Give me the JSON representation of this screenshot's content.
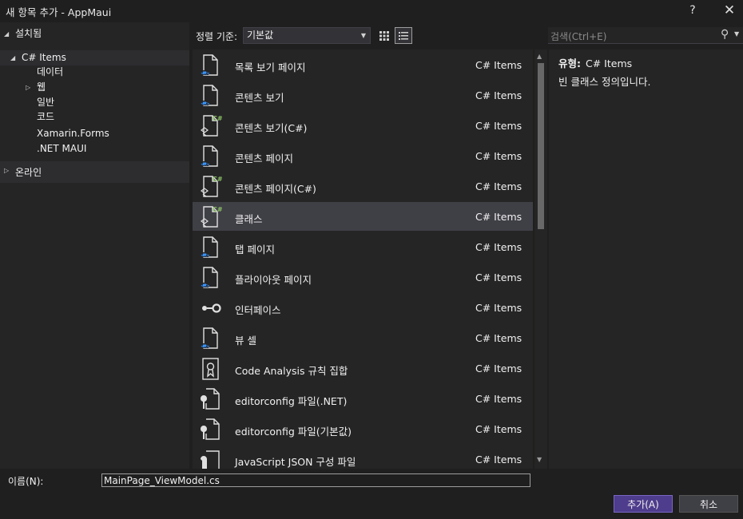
{
  "window": {
    "title": "새 항목 추가 - AppMaui",
    "help": "?",
    "close": "✕"
  },
  "left_panel": {
    "installed": "설치됨",
    "items": [
      "C# Items",
      "데이터",
      "웹",
      "일반",
      "코드",
      "Xamarin.Forms",
      ".NET MAUI"
    ],
    "online": "온라인"
  },
  "toolbar": {
    "sort_label": "정렬 기준:",
    "sort_value": "기본값"
  },
  "search": {
    "placeholder": "검색(Ctrl+E)"
  },
  "templates": [
    {
      "name": "목록 보기 페이지",
      "category": "C# Items",
      "icon": "xaml-page-icon"
    },
    {
      "name": "콘텐츠 보기",
      "category": "C# Items",
      "icon": "xaml-page-icon"
    },
    {
      "name": "콘텐츠 보기(C#)",
      "category": "C# Items",
      "icon": "csharp-page-icon"
    },
    {
      "name": "콘텐츠 페이지",
      "category": "C# Items",
      "icon": "xaml-page-icon"
    },
    {
      "name": "콘텐츠 페이지(C#)",
      "category": "C# Items",
      "icon": "csharp-page-icon"
    },
    {
      "name": "클래스",
      "category": "C# Items",
      "icon": "csharp-class-icon"
    },
    {
      "name": "탭 페이지",
      "category": "C# Items",
      "icon": "xaml-page-icon"
    },
    {
      "name": "플라이아웃 페이지",
      "category": "C# Items",
      "icon": "xaml-page-icon"
    },
    {
      "name": "인터페이스",
      "category": "C# Items",
      "icon": "interface-icon"
    },
    {
      "name": "뷰 셀",
      "category": "C# Items",
      "icon": "xaml-page-icon"
    },
    {
      "name": "Code Analysis 규칙 집합",
      "category": "C# Items",
      "icon": "ruleset-icon"
    },
    {
      "name": "editorconfig 파일(.NET)",
      "category": "C# Items",
      "icon": "config-file-icon"
    },
    {
      "name": "editorconfig 파일(기본값)",
      "category": "C# Items",
      "icon": "config-file-icon"
    },
    {
      "name": "JavaScript JSON 구성 파일",
      "category": "C# Items",
      "icon": "json-config-icon"
    }
  ],
  "detail": {
    "type_label": "유형:",
    "type_value": "C# Items",
    "description": "빈 클래스 정의입니다."
  },
  "footer": {
    "name_label": "이름(N):",
    "name_value": "MainPage_ViewModel.cs",
    "add_button": "추가(A)",
    "cancel_button": "취소"
  },
  "colors": {
    "accent": "#4e3c8c",
    "background": "#1f1f1f",
    "panel": "#252526",
    "selected": "#3f3f46",
    "icon_blue": "#3794ff",
    "csharp_green": "#8cc265"
  }
}
